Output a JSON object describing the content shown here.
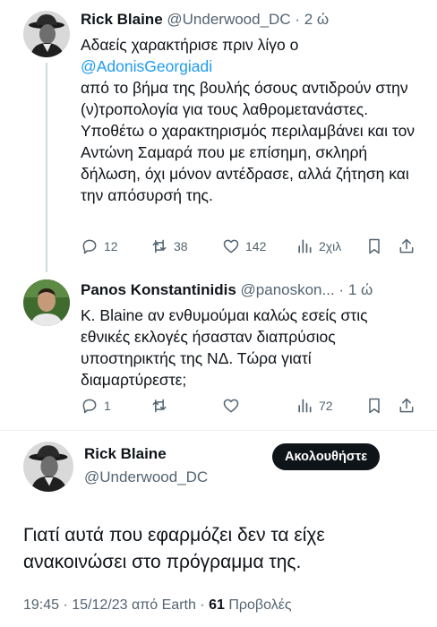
{
  "tweet1": {
    "name": "Rick Blaine",
    "handle": "@Underwood_DC",
    "dot": "·",
    "time": "2 ώ",
    "text_before": "Αδαείς χαρακτήρισε πριν λίγο ο",
    "mention": "@AdonisGeorgiadi",
    "text_after": "από το βήμα της βουλής όσους αντιδρούν στην (ν)τροπολογία για τους λαθρομετανάστες. Υποθέτω ο χαρακτηρισμός περιλαμβάνει και τον Αντώνη Σαμαρά που με επίσημη, σκληρή δήλωση, όχι μόνον αντέδρασε, αλλά ζήτηση και την απόσυρσή της.",
    "replies": "12",
    "retweets": "38",
    "likes": "142",
    "views": "2χιλ"
  },
  "tweet2": {
    "name": "Panos Konstantinidis",
    "handle": "@panoskon...",
    "dot": "·",
    "time": "1 ώ",
    "text": "Κ. Blaine αν ενθυμούμαι καλώς εσείς στις εθνικές εκλογές ήσασταν διαπρύσιος υποστηρικτής της ΝΔ. Τώρα γιατί διαμαρτύρεστε;",
    "replies": "1",
    "views": "72"
  },
  "tweet3": {
    "name": "Rick Blaine",
    "handle": "@Underwood_DC",
    "follow_label": "Ακολουθήστε",
    "text": "Γιατί αυτά που εφαρμόζει δεν τα είχε ανακοινώσει στο πρόγραμμα της.",
    "meta_prefix": "19:45 · 15/12/23 από Earth ·",
    "views_count": "61",
    "views_label": "Προβολές"
  },
  "colors": {
    "text": "#0f1419",
    "secondary": "#536471",
    "link": "#1d9bf0",
    "thread_line": "#cfd9de",
    "follow_bg": "#0f1419"
  },
  "icons": [
    "reply-icon",
    "retweet-icon",
    "like-icon",
    "views-icon",
    "bookmark-icon",
    "share-icon"
  ]
}
